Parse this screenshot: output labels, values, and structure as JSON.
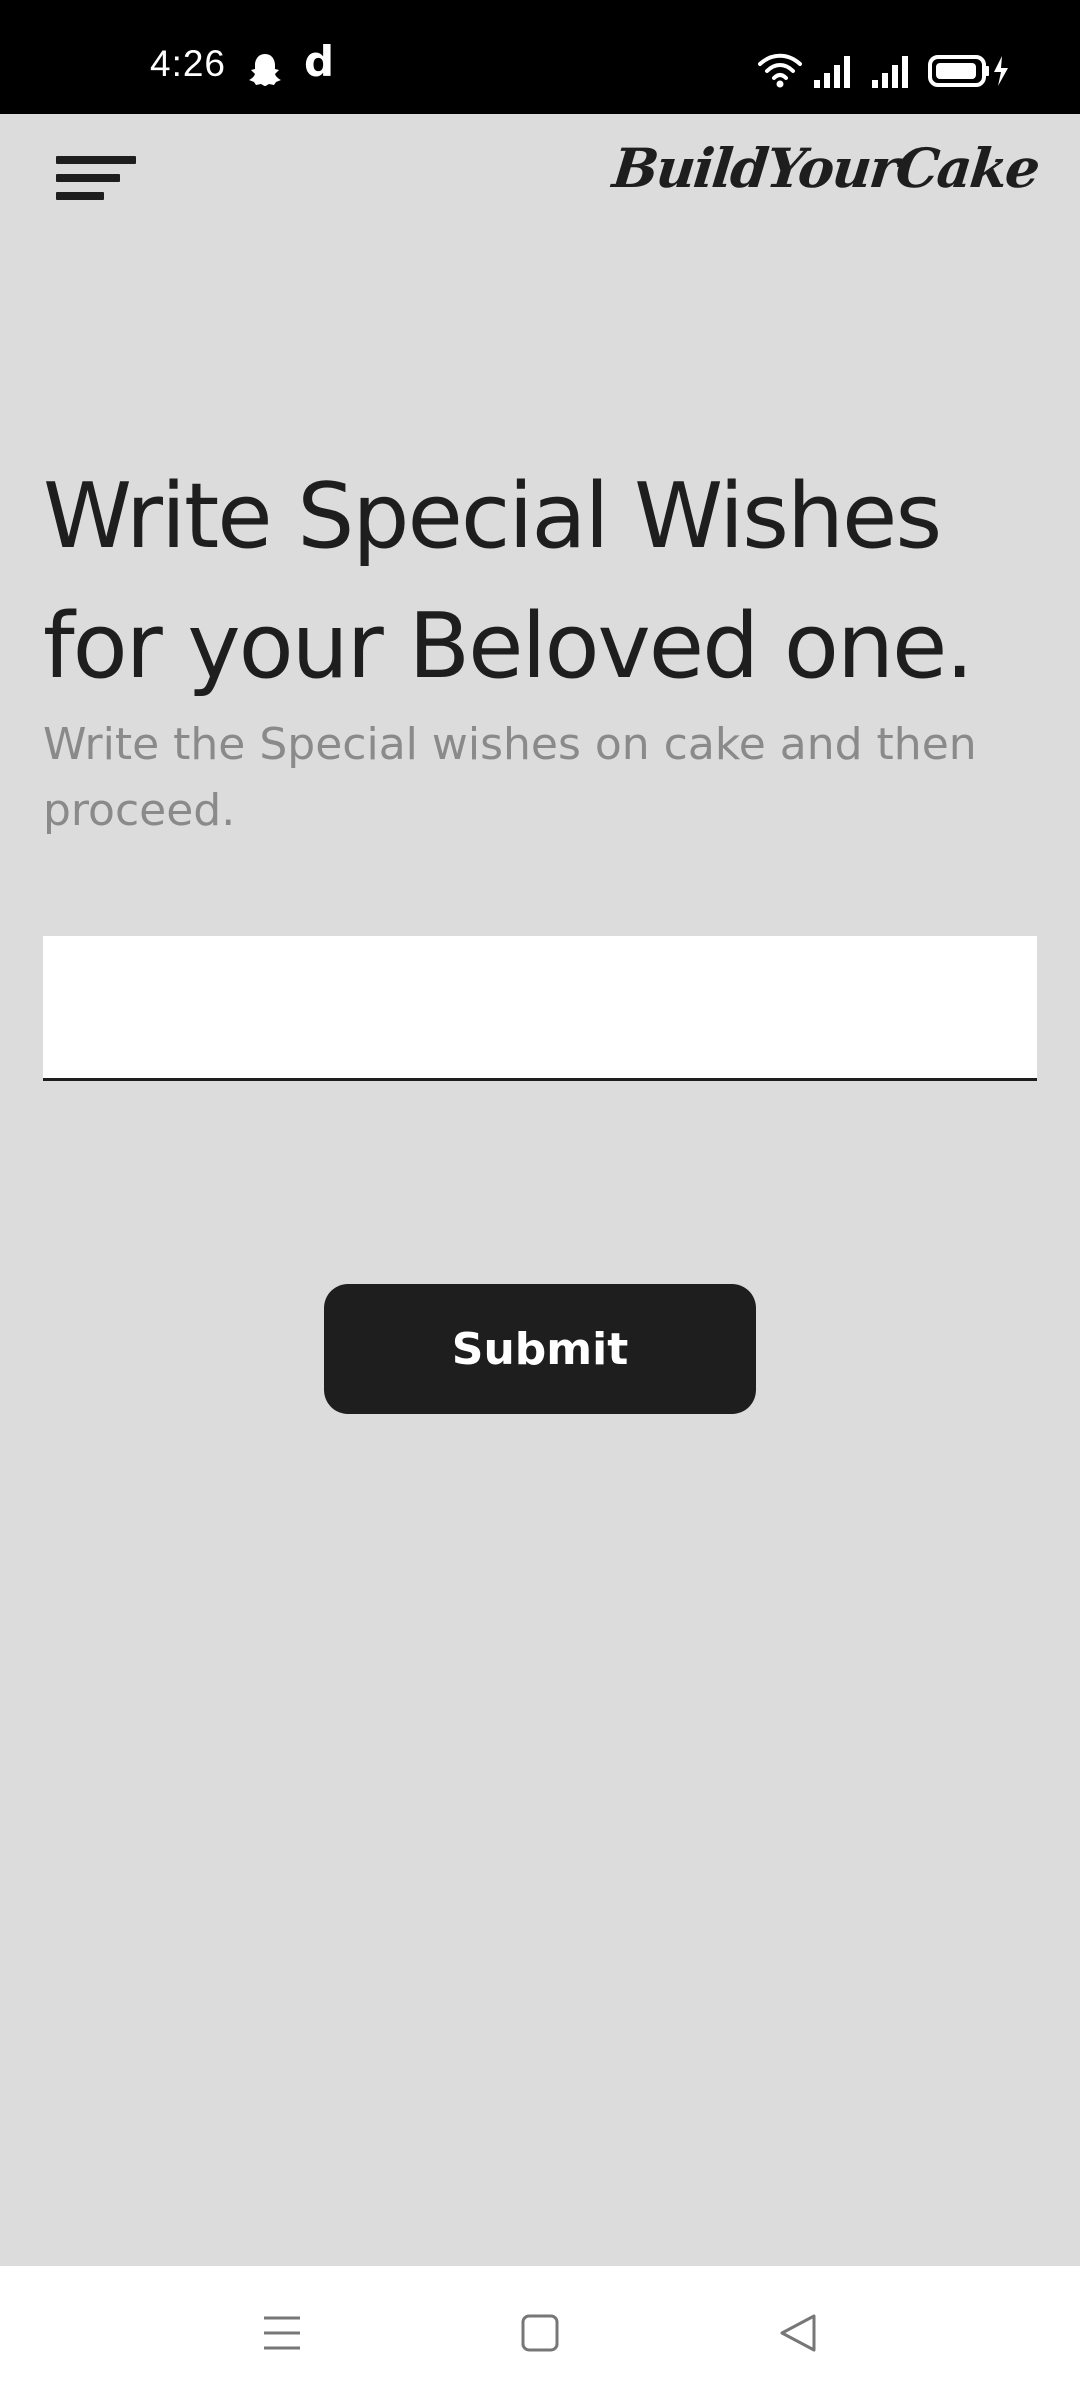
{
  "status_bar": {
    "time": "4:26",
    "icons": [
      "snapchat-icon",
      "d-app-icon",
      "wifi-icon",
      "signal-icon",
      "signal-icon",
      "battery-charging-icon"
    ],
    "d_glyph": "d"
  },
  "app_bar": {
    "menu_icon": "hamburger-menu-icon",
    "brand": "BuildYourCake"
  },
  "main": {
    "headline": "Write Special Wishes for your Beloved one.",
    "subtext": "Write the Special wishes on cake and then proceed.",
    "wish_input": {
      "value": "",
      "placeholder": ""
    },
    "submit_label": "Submit"
  },
  "nav_bar": {
    "icons": [
      "recents-icon",
      "home-icon",
      "back-icon"
    ]
  },
  "colors": {
    "background": "#dcdcdc",
    "dark": "#1e1e1e",
    "subtext": "#8a8a8a",
    "status_bar": "#000000"
  }
}
